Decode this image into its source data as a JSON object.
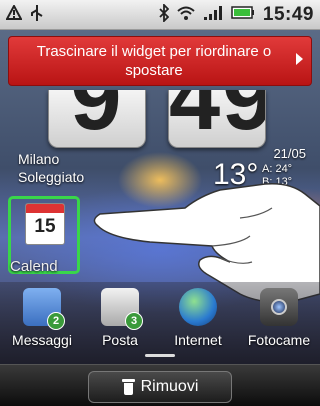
{
  "status_bar": {
    "time": "15:49",
    "left_icons": [
      "warning-icon",
      "usb-icon"
    ],
    "right_icons": [
      "bluetooth-icon",
      "wifi-icon",
      "signal-icon",
      "battery-icon"
    ]
  },
  "banner": {
    "text": "Trascinare il widget per riordinare o spostare"
  },
  "clock": {
    "hours": "9",
    "minutes": "49"
  },
  "weather": {
    "city": "Milano",
    "condition": "Soleggiato",
    "date": "21/05",
    "temperature": "13°",
    "high": "A: 24°",
    "low": "B: 13°"
  },
  "calendar_widget": {
    "day": "15",
    "label": "Calend"
  },
  "dock": {
    "apps": [
      {
        "label": "Messaggi",
        "badge": "2",
        "color": "#4a7fd0"
      },
      {
        "label": "Posta",
        "badge": "3",
        "color": "#c8c8c8"
      },
      {
        "label": "Internet",
        "badge": "",
        "color": "#3a7fd0"
      },
      {
        "label": "Fotocame",
        "badge": "",
        "color": "#555555"
      }
    ]
  },
  "bottom_bar": {
    "remove_label": "Rimuovi"
  },
  "colors": {
    "banner": "#cc2222",
    "selection": "#39d64a"
  }
}
